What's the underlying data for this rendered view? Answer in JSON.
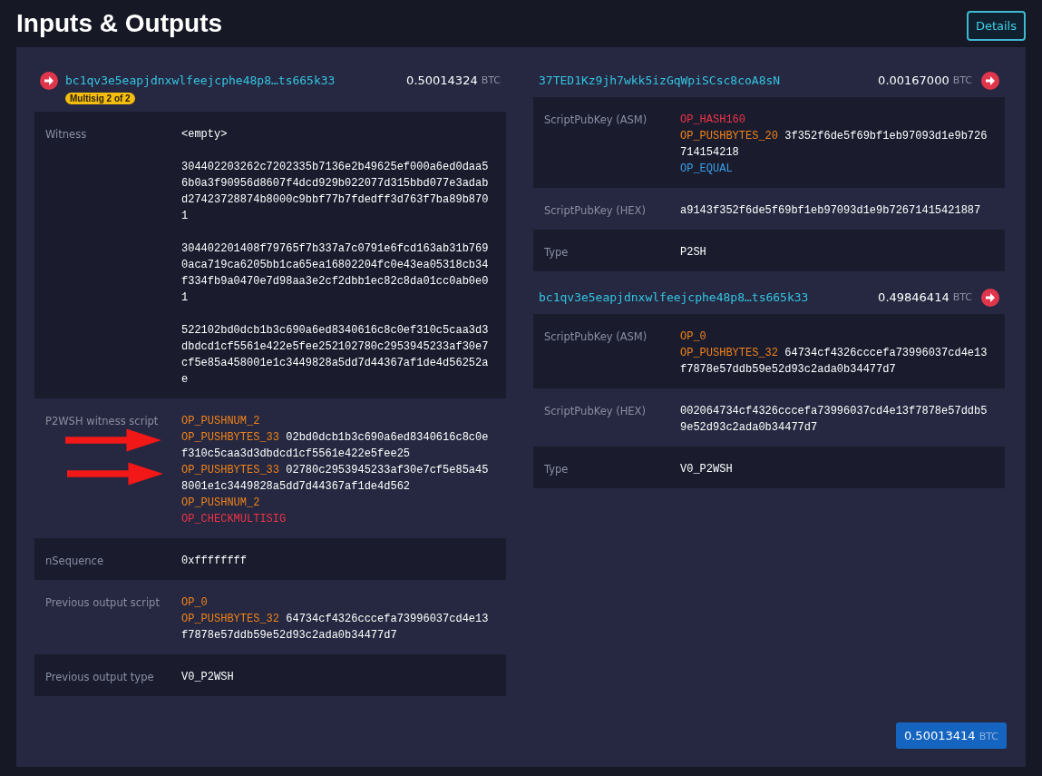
{
  "title": "Inputs & Outputs",
  "details_button": "Details",
  "inputs": [
    {
      "address": "bc1qv3e5eapjdnxwlfeejcphe48p8…ts665k33",
      "badge": "Multisig 2 of 2",
      "amount": "0.50014324",
      "unit": "BTC",
      "details": [
        {
          "label": "Witness",
          "kind": "text",
          "paragraphs": [
            "<empty>",
            "304402203262c7202335b7136e2b49625ef000a6ed0daa56b0a3f90956d8607f4dcd929b022077d315bbd077e3adabd27423728874b8000c9bbf77b7fdedff3d763f7ba89b8701",
            "304402201408f79765f7b337a7c0791e6fcd163ab31b7690aca719ca6205bb1ca65ea16802204fc0e43ea05318cb34f334fb9a0470e7d98aa3e2cf2dbb1ec82c8da01cc0ab0e01",
            "522102bd0dcb1b3c690a6ed8340616c8c0ef310c5caa3d3dbdcd1cf5561e422e5fee252102780c2953945233af30e7cf5e85a458001e1c3449828a5dd7d44367af1de4d56252ae"
          ]
        },
        {
          "label": "P2WSH witness script",
          "kind": "script",
          "ops": [
            {
              "op": "OP_PUSHNUM_2",
              "kind": "push"
            },
            {
              "op": "OP_PUSHBYTES_33",
              "kind": "push",
              "data": "02bd0dcb1b3c690a6ed8340616c8c0ef310c5caa3d3dbdcd1cf5561e422e5fee25"
            },
            {
              "op": "OP_PUSHBYTES_33",
              "kind": "push",
              "data": "02780c2953945233af30e7cf5e85a458001e1c3449828a5dd7d44367af1de4d562"
            },
            {
              "op": "OP_PUSHNUM_2",
              "kind": "push"
            },
            {
              "op": "OP_CHECKMULTISIG",
              "kind": "crypto"
            }
          ]
        },
        {
          "label": "nSequence",
          "kind": "text",
          "paragraphs": [
            "0xffffffff"
          ]
        },
        {
          "label": "Previous output script",
          "kind": "script",
          "ops": [
            {
              "op": "OP_0",
              "kind": "push"
            },
            {
              "op": "OP_PUSHBYTES_32",
              "kind": "push",
              "data": "64734cf4326cccefa73996037cd4e13f7878e57ddb59e52d93c2ada0b34477d7"
            }
          ]
        },
        {
          "label": "Previous output type",
          "kind": "text",
          "paragraphs": [
            "V0_P2WSH"
          ]
        }
      ]
    }
  ],
  "outputs": [
    {
      "address": "37TED1Kz9jh7wkk5izGqWpiSCsc8coA8sN",
      "amount": "0.00167000",
      "unit": "BTC",
      "details": [
        {
          "label": "ScriptPubKey (ASM)",
          "kind": "script",
          "ops": [
            {
              "op": "OP_HASH160",
              "kind": "crypto"
            },
            {
              "op": "OP_PUSHBYTES_20",
              "kind": "push",
              "data": "3f352f6de5f69bf1eb97093d1e9b726714154218"
            },
            {
              "op": "OP_EQUAL",
              "kind": "compare"
            }
          ]
        },
        {
          "label": "ScriptPubKey (HEX)",
          "kind": "text",
          "paragraphs": [
            "a9143f352f6de5f69bf1eb97093d1e9b72671415421887"
          ]
        },
        {
          "label": "Type",
          "kind": "text",
          "paragraphs": [
            "P2SH"
          ]
        }
      ]
    },
    {
      "address": "bc1qv3e5eapjdnxwlfeejcphe48p8…ts665k33",
      "amount": "0.49846414",
      "unit": "BTC",
      "details": [
        {
          "label": "ScriptPubKey (ASM)",
          "kind": "script",
          "ops": [
            {
              "op": "OP_0",
              "kind": "push"
            },
            {
              "op": "OP_PUSHBYTES_32",
              "kind": "push",
              "data": "64734cf4326cccefa73996037cd4e13f7878e57ddb59e52d93c2ada0b34477d7"
            }
          ]
        },
        {
          "label": "ScriptPubKey (HEX)",
          "kind": "text",
          "paragraphs": [
            "002064734cf4326cccefa73996037cd4e13f7878e57ddb59e52d93c2ada0b34477d7"
          ]
        },
        {
          "label": "Type",
          "kind": "text",
          "paragraphs": [
            "V0_P2WSH"
          ]
        }
      ]
    }
  ],
  "total": {
    "amount": "0.50013414",
    "unit": "BTC"
  }
}
